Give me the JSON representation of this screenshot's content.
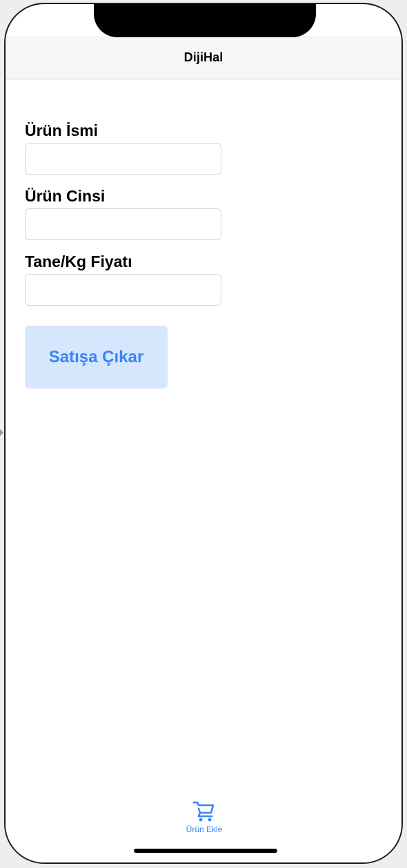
{
  "nav": {
    "title": "DijiHal"
  },
  "form": {
    "name_label": "Ürün İsmi",
    "name_value": "",
    "type_label": "Ürün Cinsi",
    "type_value": "",
    "price_label": "Tane/Kg Fiyatı",
    "price_value": ""
  },
  "actions": {
    "submit_label": "Satışa Çıkar"
  },
  "tab_bar": {
    "items": [
      {
        "label": "Ürün Ekle",
        "icon": "cart-icon",
        "selected": true
      }
    ]
  },
  "colors": {
    "accent": "#3a84f6",
    "button_background": "#d6e6fd",
    "nav_background": "#f6f6f6"
  }
}
